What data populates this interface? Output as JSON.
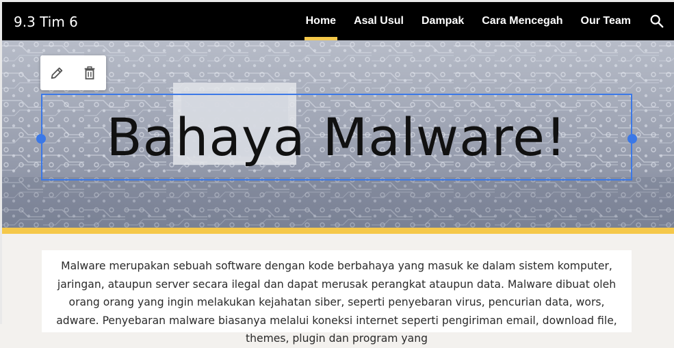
{
  "header": {
    "site_title": "9.3 Tim 6",
    "nav": [
      {
        "label": "Home",
        "active": true
      },
      {
        "label": "Asal Usul",
        "active": false
      },
      {
        "label": "Dampak",
        "active": false
      },
      {
        "label": "Cara Mencegah",
        "active": false
      },
      {
        "label": "Our Team",
        "active": false
      }
    ],
    "search_icon": "search-icon"
  },
  "hero": {
    "title": "Bahaya Malware!",
    "background": "circuit-board-image",
    "accent_color": "#f5c84a"
  },
  "editor": {
    "tools": [
      "edit-icon",
      "delete-icon"
    ],
    "selection_color": "#3b78e7"
  },
  "content": {
    "paragraph": "Malware merupakan sebuah software dengan kode berbahaya yang masuk ke dalam sistem komputer, jaringan, ataupun server secara ilegal dan dapat merusak perangkat ataupun data. Malware dibuat oleh orang orang yang ingin melakukan kejahatan siber, seperti penyebaran virus, pencurian data, wors, adware. Penyebaran malware biasanya melalui koneksi internet seperti pengiriman email, download file, themes, plugin dan program yang"
  }
}
